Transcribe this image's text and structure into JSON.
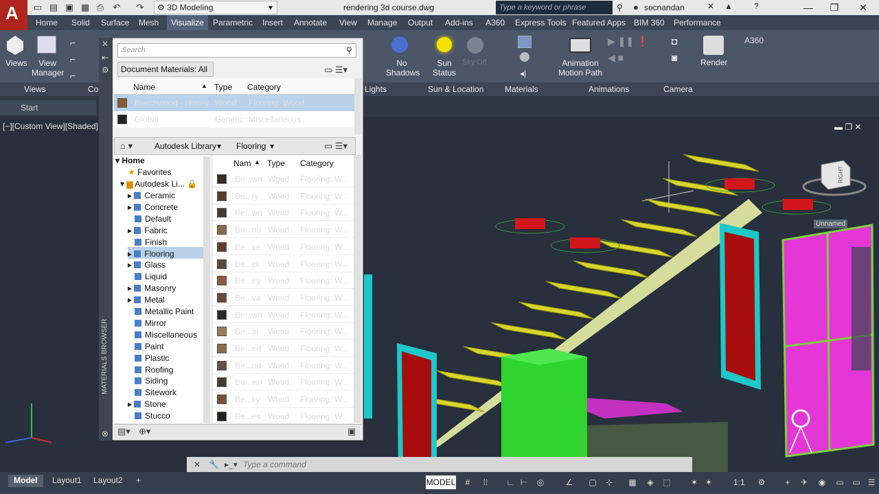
{
  "app": {
    "logo": "A",
    "workspace": "3D Modeling",
    "document_title": "rendering 3d course.dwg",
    "search_placeholder": "Type a keyword or phrase",
    "user": "socnandan"
  },
  "tabs": [
    "Home",
    "Solid",
    "Surface",
    "Mesh",
    "Visualize",
    "Parametric",
    "Insert",
    "Annotate",
    "View",
    "Manage",
    "Output",
    "Add-ins",
    "A360",
    "Express Tools",
    "Featured Apps",
    "BIM 360",
    "Performance"
  ],
  "active_tab": "Visualize",
  "ribbon": {
    "views_label": "Views",
    "view_manager_label": "View Manager",
    "no_shadows_label": "No Shadows",
    "sun_status_label": "Sun Status",
    "sky_off_label": "Sky Off",
    "animation_label": "Animation Motion Path",
    "render_label": "Render",
    "a360_label": "A360",
    "panels": {
      "views": "Views",
      "co": "Co",
      "lights": "Lights",
      "sun": "Sun & Location",
      "materials": "Materials",
      "animations": "Animations",
      "camera": "Camera"
    }
  },
  "file_tab": "Start",
  "viewport_label": "[−][Custom View][Shaded]",
  "viewcube_label": "RIGHT",
  "unnamed_label": "Unnamed",
  "materials_browser": {
    "title": "MATERIALS BROWSER",
    "search_placeholder": "Search",
    "doc_filter": "Document Materials: All",
    "doc_columns": [
      "Name",
      "Type",
      "Category"
    ],
    "doc_rows": [
      {
        "name": "Beechwood - Honey",
        "type": "Wood",
        "category": "Flooring: Wood",
        "color": "#8a5a30"
      },
      {
        "name": "Global",
        "type": "Generic",
        "category": "Miscellaneous",
        "color": "#222222"
      }
    ],
    "library_path": [
      "Autodesk Library",
      "Flooring"
    ],
    "tree": {
      "home": "Home",
      "favorites": "Favorites",
      "library": "Autodesk Li...",
      "items": [
        "Ceramic",
        "Concrete",
        "Default",
        "Fabric",
        "Finish",
        "Flooring",
        "Glass",
        "Liquid",
        "Masonry",
        "Metal",
        "Metallic Paint",
        "Mirror",
        "Miscellaneous",
        "Paint",
        "Plastic",
        "Roofing",
        "Siding",
        "Sitework",
        "Stone",
        "Stucco"
      ]
    },
    "lib_columns": [
      "Nam",
      "Type",
      "Category"
    ],
    "lib_rows": [
      {
        "name": "Be...wn",
        "type": "Wood",
        "category": "Flooring: W...",
        "color": "#3a2a20"
      },
      {
        "name": "Be...ry",
        "type": "Wood",
        "category": "Flooring: W...",
        "color": "#5a3a28"
      },
      {
        "name": "Be...wn",
        "type": "Wood",
        "category": "Flooring: W...",
        "color": "#4a3a30"
      },
      {
        "name": "Be...no",
        "type": "Wood",
        "category": "Flooring: W...",
        "color": "#8a6a4a"
      },
      {
        "name": "Be...ve",
        "type": "Wood",
        "category": "Flooring: W...",
        "color": "#6a3a28"
      },
      {
        "name": "Be...ck",
        "type": "Wood",
        "category": "Flooring: W...",
        "color": "#5a4838"
      },
      {
        "name": "Be...ey",
        "type": "Wood",
        "category": "Flooring: W...",
        "color": "#8a5a3a"
      },
      {
        "name": "Be...va",
        "type": "Wood",
        "category": "Flooring: W...",
        "color": "#6a4a38"
      },
      {
        "name": "Be...wn",
        "type": "Wood",
        "category": "Flooring: W...",
        "color": "#2a2a2a"
      },
      {
        "name": "Be...al",
        "type": "Wood",
        "category": "Flooring: W...",
        "color": "#9a7a58"
      },
      {
        "name": "Be...ed",
        "type": "Wood",
        "category": "Flooring: W...",
        "color": "#8a6a4a"
      },
      {
        "name": "Be...od",
        "type": "Wood",
        "category": "Flooring: W...",
        "color": "#6a5040"
      },
      {
        "name": "Be...wn",
        "type": "Wood",
        "category": "Flooring: W...",
        "color": "#4a3a2a"
      },
      {
        "name": "Be...ky",
        "type": "Wood",
        "category": "Flooring: W...",
        "color": "#7a5030"
      },
      {
        "name": "Be...es",
        "type": "Wood",
        "category": "Flooring: W...",
        "color": "#2a2020"
      }
    ]
  },
  "command_placeholder": "Type a command",
  "layout_tabs": [
    "Model",
    "Layout1",
    "Layout2"
  ],
  "status": {
    "model": "MODEL",
    "scale": "1:1"
  }
}
